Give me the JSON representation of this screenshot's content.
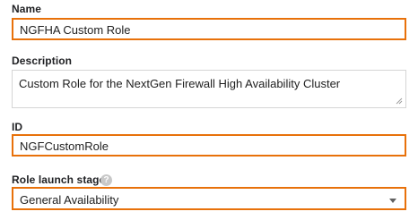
{
  "name": {
    "label": "Name",
    "value": "NGFHA Custom Role"
  },
  "description": {
    "label": "Description",
    "value": "Custom Role for the NextGen Firewall High Availability Cluster"
  },
  "id": {
    "label": "ID",
    "value": "NGFCustomRole"
  },
  "launch_stage": {
    "label": "Role launch stage",
    "help_icon": "?",
    "selected": "General Availability"
  },
  "colors": {
    "highlight_border": "#e8710a",
    "plain_border": "#d5d5d5",
    "text": "#212121",
    "help_icon_bg": "#c8c8c8"
  },
  "icons": {
    "help": "help-icon",
    "dropdown": "chevron-down-icon",
    "resize": "resize-handle-icon"
  }
}
